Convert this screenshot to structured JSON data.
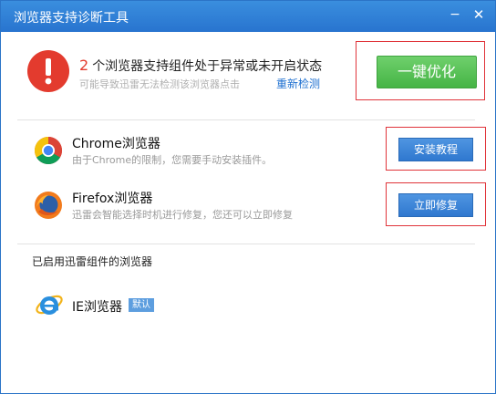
{
  "window": {
    "title": "浏览器支持诊断工具",
    "minimize_glyph": "−",
    "close_glyph": "✕"
  },
  "summary": {
    "count": "2",
    "message": "个浏览器支持组件处于异常或未开启状态",
    "hint": "可能导致迅雷无法检测该浏览器点击",
    "recheck_link": "重新检测",
    "optimize_button": "一键优化"
  },
  "browsers": [
    {
      "name": "Chrome浏览器",
      "desc": "由于Chrome的限制，您需要手动安装插件。",
      "action": "安装教程",
      "icon": "chrome-icon"
    },
    {
      "name": "Firefox浏览器",
      "desc": "迅雷会智能选择时机进行修复，您还可以立即修复",
      "action": "立即修复",
      "icon": "firefox-icon"
    }
  ],
  "enabled_section": {
    "title": "已启用迅雷组件的浏览器",
    "browser": {
      "name": "IE浏览器",
      "badge": "默认",
      "icon": "ie-icon"
    }
  },
  "colors": {
    "titlebar": "#2f7fd8",
    "green_button": "#52bd50",
    "blue_button": "#3b84d6",
    "alert": "#e33b2e",
    "highlight_box": "#e0343a"
  }
}
